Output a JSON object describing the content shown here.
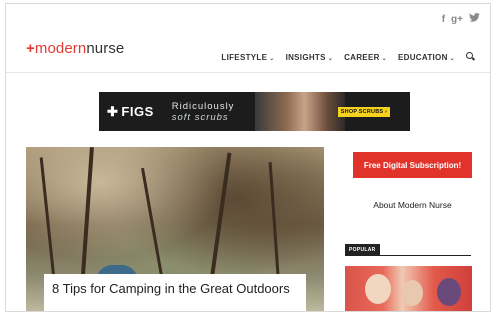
{
  "site": {
    "logo": {
      "plus": "+",
      "modern": "modern",
      "nurse": "nurse"
    },
    "social_icons": [
      {
        "name": "facebook-icon",
        "glyph": "f"
      },
      {
        "name": "google-plus-icon",
        "glyph": "g+"
      },
      {
        "name": "twitter-icon",
        "glyph": "🐦"
      }
    ]
  },
  "nav": {
    "items": [
      {
        "label": "LIFESTYLE",
        "chevron": "⌄"
      },
      {
        "label": "INSIGHTS",
        "chevron": "⌄"
      },
      {
        "label": "CAREER",
        "chevron": "⌄"
      },
      {
        "label": "EDUCATION",
        "chevron": "⌄"
      }
    ]
  },
  "ad": {
    "brand": "FIGS",
    "tagline_line1": "Ridiculously",
    "tagline_line2": "soft scrubs",
    "button": "SHOP SCRUBS ›"
  },
  "hero": {
    "title": "8 Tips for Camping in the Great Outdoors"
  },
  "sidebar": {
    "subscribe_label": "Free Digital Subscription!",
    "about_label": "About Modern Nurse",
    "popular_label": "POPULAR"
  },
  "colors": {
    "brand_red": "#e2332b",
    "dark": "#222222"
  }
}
